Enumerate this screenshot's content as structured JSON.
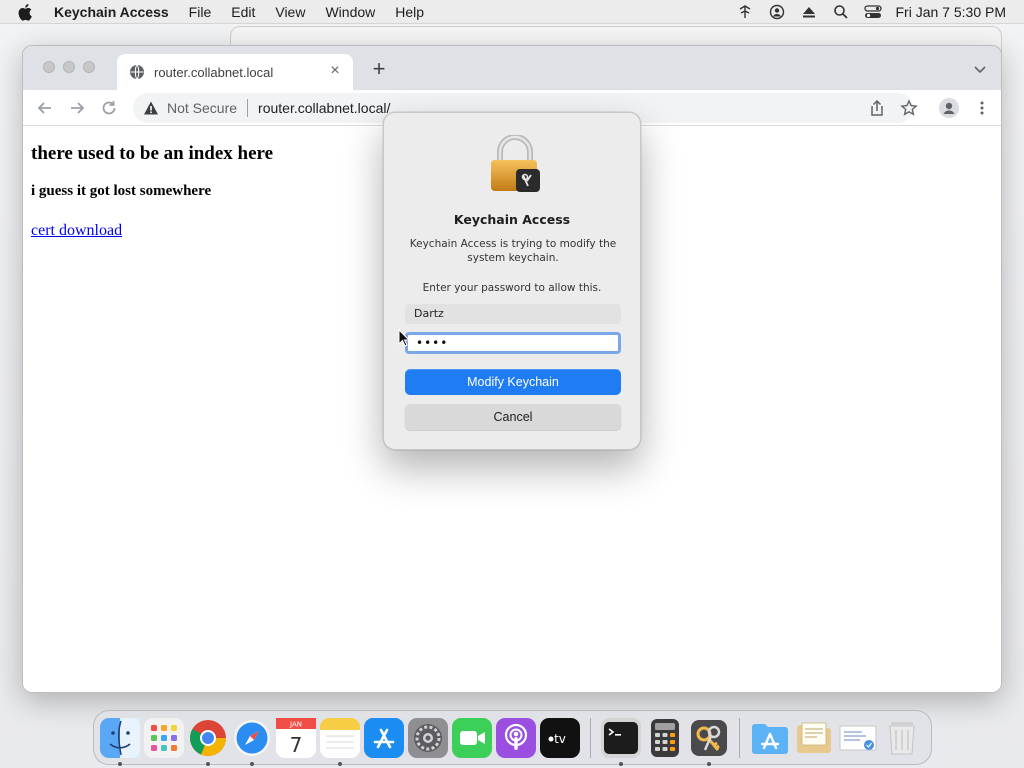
{
  "menubar": {
    "app_name": "Keychain Access",
    "items": [
      "File",
      "Edit",
      "View",
      "Window",
      "Help"
    ],
    "clock": "Fri Jan 7  5:30 PM"
  },
  "browser": {
    "tab_title": "router.collabnet.local",
    "security_label": "Not Secure",
    "url": "router.collabnet.local/"
  },
  "page": {
    "heading": "there used to be an index here",
    "subheading": "i guess it got lost somewhere",
    "link": "cert download"
  },
  "dialog": {
    "title": "Keychain Access",
    "message": "Keychain Access is trying to modify the system keychain.",
    "prompt": "Enter your password to allow this.",
    "username": "Dartz",
    "password_mask": "••••",
    "primary_button": "Modify Keychain",
    "cancel_button": "Cancel"
  },
  "calendar_icon": {
    "month": "JAN",
    "day": "7"
  },
  "dock": {
    "items": [
      "finder-icon",
      "launchpad-icon",
      "chrome-icon",
      "safari-icon",
      "calendar-icon",
      "notes-icon",
      "app-store-icon",
      "system-preferences-icon",
      "facetime-icon",
      "podcasts-icon",
      "apple-tv-icon",
      "terminal-icon",
      "calculator-icon",
      "keychain-access-icon",
      "applications-folder-icon",
      "documents-stack-icon",
      "certificate-file-icon",
      "trash-icon"
    ]
  },
  "colors": {
    "accent": "#1f7cf2",
    "link": "#0000ee",
    "focus_ring": "#7aa7e8"
  }
}
